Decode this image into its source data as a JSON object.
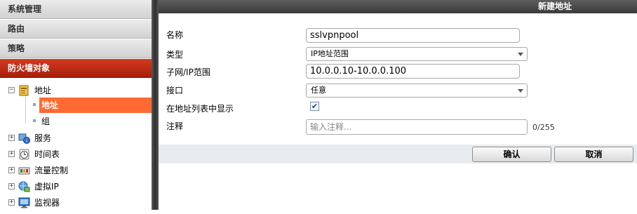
{
  "sidebar": {
    "sections": [
      {
        "label": "系统管理"
      },
      {
        "label": "路由"
      },
      {
        "label": "策略"
      },
      {
        "label": "防火墙对象",
        "active": true
      }
    ],
    "tree": {
      "address": {
        "label": "地址",
        "children": [
          {
            "label": "地址",
            "selected": true
          },
          {
            "label": "组"
          }
        ]
      },
      "service": {
        "label": "服务"
      },
      "schedule": {
        "label": "时间表"
      },
      "traffic": {
        "label": "流量控制"
      },
      "vip": {
        "label": "虚拟IP"
      },
      "monitor": {
        "label": "监视器"
      }
    },
    "expand_symbol_open": "−",
    "expand_symbol_closed": "+"
  },
  "main": {
    "title": "新建地址",
    "form": {
      "name": {
        "label": "名称",
        "value": "sslvpnpool"
      },
      "type": {
        "label": "类型",
        "value": "IP地址范围"
      },
      "subnet": {
        "label": "子网/IP范围",
        "value": "10.0.0.10-10.0.0.100"
      },
      "interface": {
        "label": "接口",
        "value": "任意"
      },
      "show_in_list": {
        "label": "在地址列表中显示",
        "checked": true,
        "check_mark": "✔"
      },
      "comment": {
        "label": "注释",
        "placeholder": "输入注释...",
        "counter": "0/255"
      }
    },
    "buttons": {
      "ok": "确认",
      "cancel": "取消"
    }
  },
  "colors": {
    "active_section": "#b82a12",
    "selected_item": "#ff6a33",
    "title_bar": "#474747"
  }
}
